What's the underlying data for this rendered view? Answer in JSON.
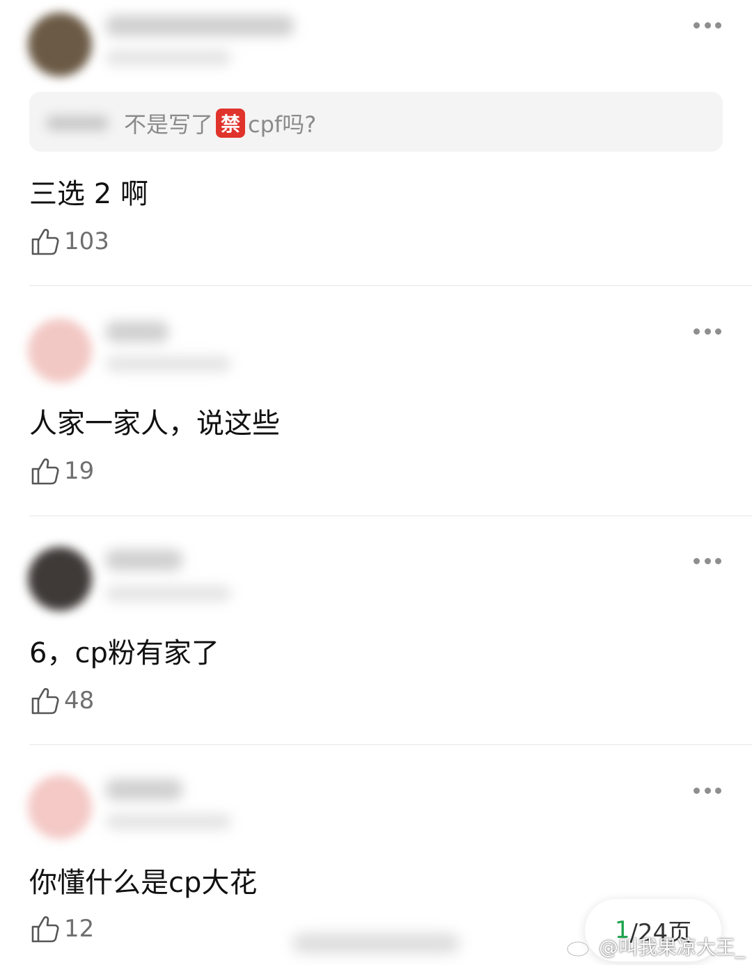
{
  "comments": [
    {
      "id": 1,
      "quote": {
        "text_before": "不是写了",
        "badge": "禁",
        "text_after": "cpf吗?"
      },
      "text": "三选 2 啊",
      "likes": "103",
      "avatar_color": "#6b5a45"
    },
    {
      "id": 2,
      "text": "人家一家人，说这些",
      "likes": "19",
      "avatar_color": "#f2c8c4"
    },
    {
      "id": 3,
      "text": "6，cp粉有家了",
      "likes": "48",
      "avatar_color": "#3f3a38"
    },
    {
      "id": 4,
      "text": "你懂什么是cp大花",
      "likes": "12",
      "avatar_color": "#f4c9c6"
    }
  ],
  "pager": {
    "current": "1",
    "total": "/24页"
  },
  "watermark": {
    "handle": "@叫我果凉大王_"
  },
  "icons": {
    "like": "thumbs-up-icon",
    "more": "more-dots-icon",
    "brand": "weibo-logo-icon"
  },
  "colors": {
    "badge": "#e0332b",
    "pager_current": "#1aa34a"
  }
}
